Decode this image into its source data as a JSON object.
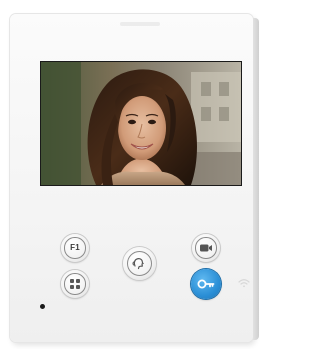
{
  "device": {
    "screen": {
      "content": "video-feed-visitor"
    },
    "buttons": [
      {
        "id": "f1",
        "label": "F1",
        "icon": "f1-label"
      },
      {
        "id": "menu",
        "icon": "grid-four-icon"
      },
      {
        "id": "talk",
        "icon": "speak-icon"
      },
      {
        "id": "camera",
        "icon": "camera-icon"
      },
      {
        "id": "door-open",
        "icon": "key-icon",
        "color": "#2b8fd6"
      }
    ],
    "status": {
      "led_color": "#1a1a1a",
      "wifi_icon": "wifi-icon"
    }
  }
}
